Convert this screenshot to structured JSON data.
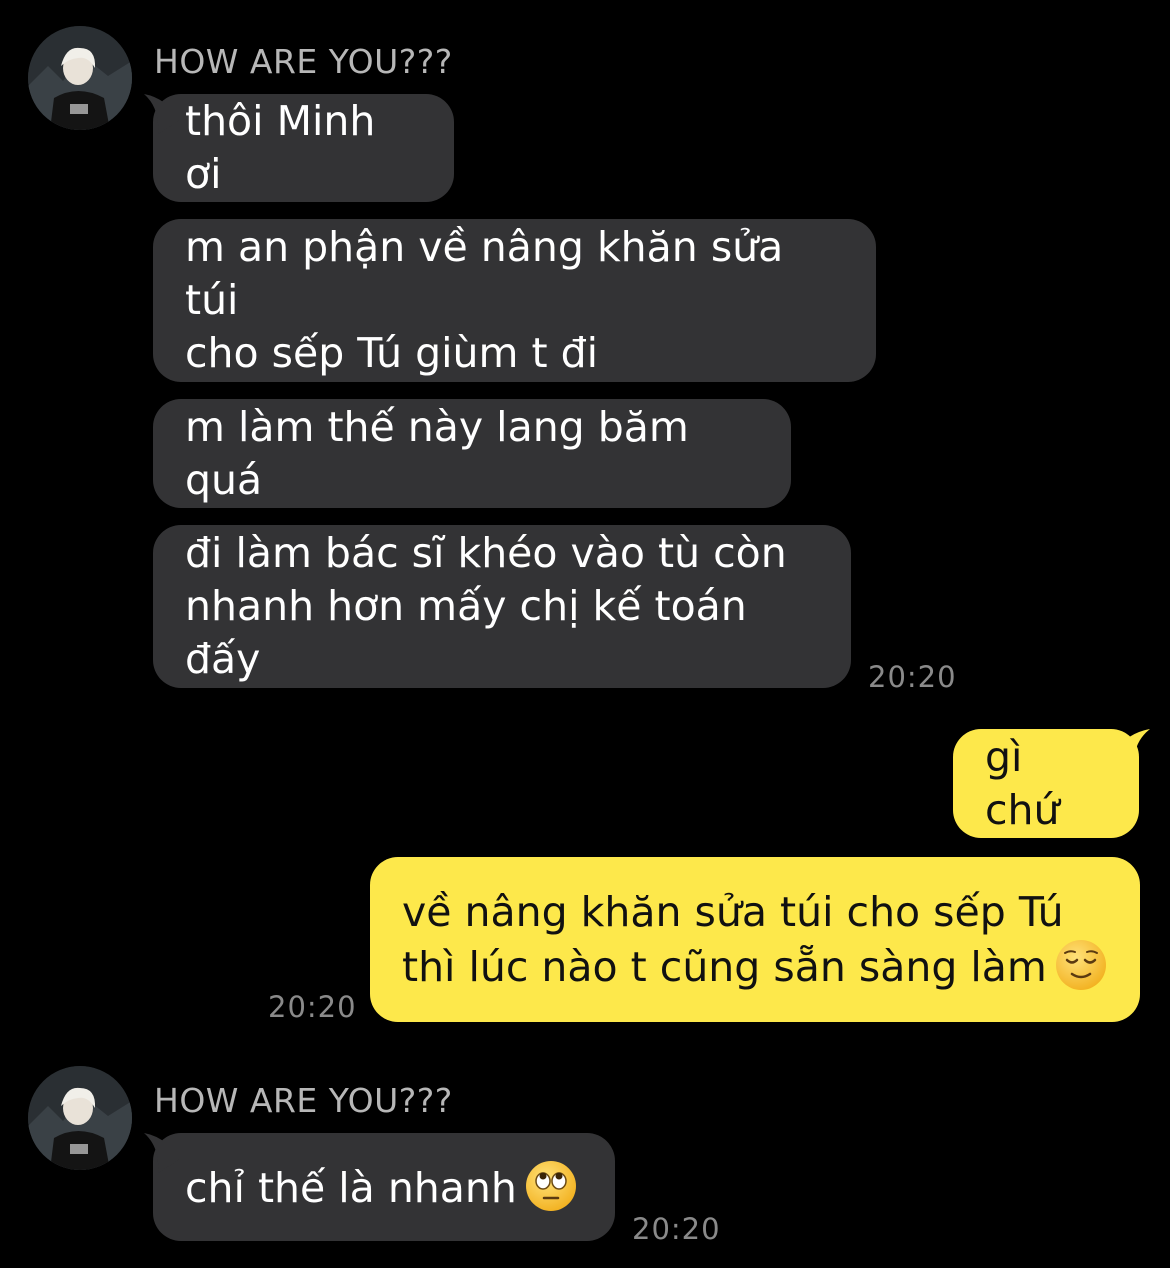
{
  "colors": {
    "background": "#000000",
    "incoming_bubble": "#333335",
    "outgoing_bubble": "#fde84b",
    "sender_name": "#b7b7b7",
    "timestamp": "#8a8a8a"
  },
  "groups": [
    {
      "sender": "HOW ARE YOU???",
      "avatar_icon": "profile-photo-avatar",
      "messages": [
        "thôi Minh ơi",
        "m an phận về nâng khăn sửa túi\ncho sếp Tú giùm t đi",
        "m làm thế này lang băm quá",
        "đi làm bác sĩ khéo vào tù còn\nnhanh hơn mấy chị kế toán đấy"
      ],
      "time": "20:20"
    },
    {
      "sender": "me",
      "messages": [
        "gì chứ",
        "về nâng khăn sửa túi cho sếp Tú\nthì lúc nào t cũng sẵn sàng làm"
      ],
      "emoji": "relieved-face-emoji",
      "time": "20:20"
    },
    {
      "sender": "HOW ARE YOU???",
      "avatar_icon": "profile-photo-avatar",
      "messages": [
        "chỉ thế là nhanh"
      ],
      "emoji": "eye-roll-face-emoji",
      "time": "20:20"
    }
  ]
}
